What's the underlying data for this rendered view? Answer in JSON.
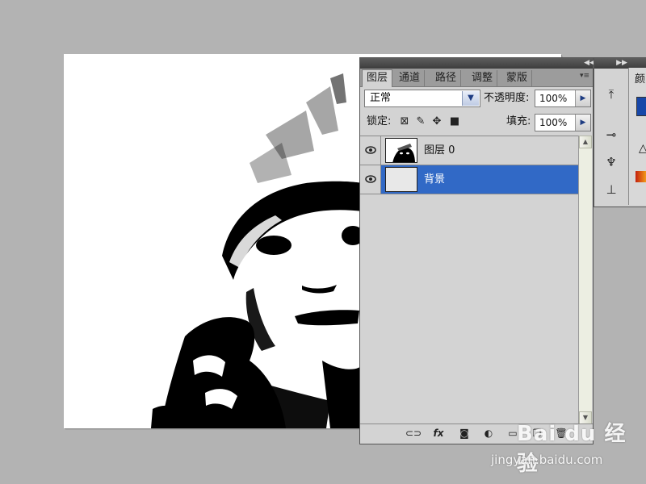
{
  "layers_panel": {
    "tabs": [
      {
        "label": "图层",
        "active": true
      },
      {
        "label": "通道",
        "active": false
      },
      {
        "label": "路径",
        "active": false
      },
      {
        "label": "调整",
        "active": false
      },
      {
        "label": "蒙版",
        "active": false
      }
    ],
    "blend_mode": "正常",
    "opacity_label": "不透明度:",
    "opacity_value": "100%",
    "lock_label": "锁定:",
    "fill_label": "填充:",
    "fill_value": "100%",
    "layers": [
      {
        "name": "图层 0",
        "visible": true,
        "selected": false
      },
      {
        "name": "背景",
        "visible": true,
        "selected": true
      }
    ]
  },
  "color_panel": {
    "tab_label": "颜",
    "swatch_color": "#1747a8"
  },
  "colors": {
    "selection": "#3169c6",
    "panel_bg": "#d3d3d3",
    "workspace_bg": "#b3b3b3"
  },
  "watermark": {
    "logo_text": "Bai du 经验",
    "url": "jingyan.baidu.com"
  }
}
